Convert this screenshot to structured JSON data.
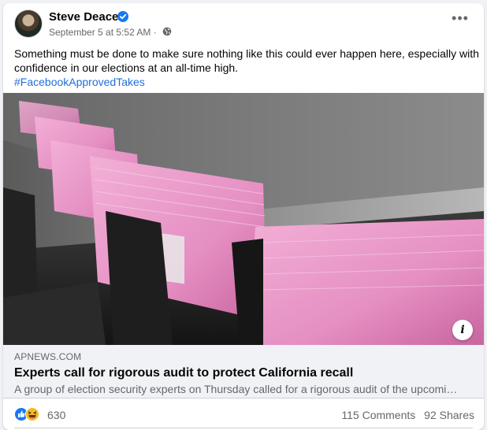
{
  "post": {
    "author": "Steve Deace",
    "timestamp": "September 5 at 5:52 AM",
    "separator": "·",
    "more_label": "•••",
    "text": "Something must be done to make sure nothing like this could ever happen here, especially with confidence in our elections at an all-time high.",
    "hashtag": "#FacebookApprovedTakes"
  },
  "link": {
    "domain": "APNEWS.COM",
    "headline": "Experts call for rigorous audit to protect California recall",
    "description": "A group of election security experts on Thursday called for a rigorous audit of the upcomi…",
    "info_label": "i"
  },
  "engagement": {
    "reaction_count": "630",
    "comments": "115 Comments",
    "shares": "92 Shares"
  },
  "colors": {
    "accent": "#1877f2",
    "hashtag": "#216fdb",
    "ballot_pink": "#e58fc3",
    "muted_text": "#65676b"
  },
  "icons": [
    "verified-badge-icon",
    "globe-icon",
    "more-icon",
    "info-icon",
    "like-reaction-icon",
    "haha-reaction-icon"
  ]
}
